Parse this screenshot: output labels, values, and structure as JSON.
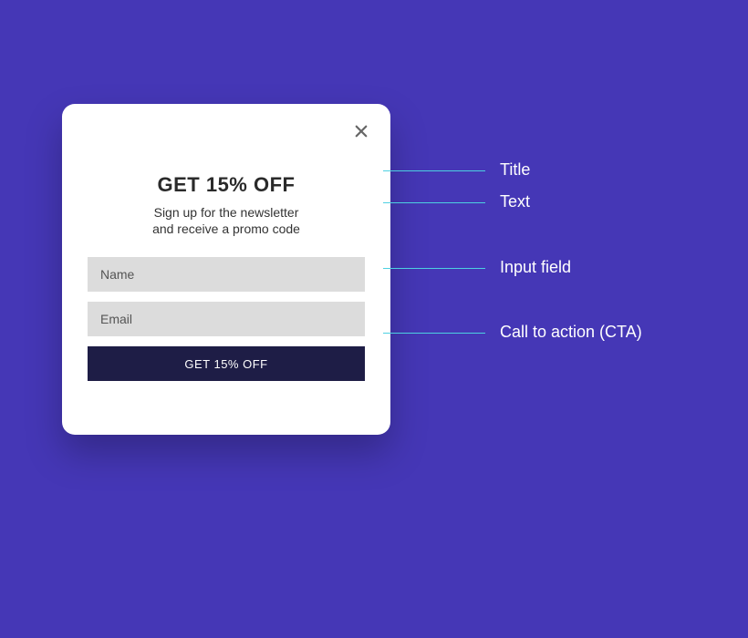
{
  "popup": {
    "title": "GET 15% OFF",
    "subtitle_line1": "Sign up for the newsletter",
    "subtitle_line2": "and receive a promo code",
    "name_placeholder": "Name",
    "email_placeholder": "Email",
    "cta_label": "GET 15% OFF"
  },
  "annotations": {
    "title": "Title",
    "text": "Text",
    "input_field": "Input field",
    "cta": "Call to action (CTA)"
  },
  "colors": {
    "background": "#4537b6",
    "popup_bg": "#ffffff",
    "input_bg": "#dcdcdc",
    "button_bg": "#1e1d46",
    "line": "#4dd0e1"
  }
}
